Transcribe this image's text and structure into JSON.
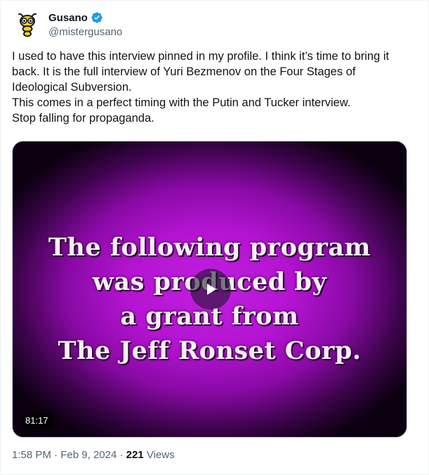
{
  "author": {
    "display_name": "Gusano",
    "handle": "@mistergusano",
    "verified": true,
    "avatar_icon": "bug-face-icon"
  },
  "tweet": {
    "lines": [
      "I used to have this interview pinned in my profile. I think it’s time to bring it back. It is the full interview of Yuri Bezmenov on the Four Stages of Ideological Subversion.",
      "This comes in a perfect timing with the Putin and Tucker interview.",
      "Stop falling for propaganda."
    ]
  },
  "video": {
    "caption_lines": [
      "The following program",
      "was produced by",
      "a grant from",
      "The Jeff Ronset Corp."
    ],
    "duration": "81:17",
    "background_color": "#b414d2"
  },
  "meta": {
    "time": "1:58 PM",
    "separator": "·",
    "date": "Feb 9, 2024",
    "views_count": "221",
    "views_label": "Views"
  },
  "colors": {
    "text_primary": "#0f1419",
    "text_secondary": "#536471",
    "verified_blue": "#1d9bf0"
  }
}
